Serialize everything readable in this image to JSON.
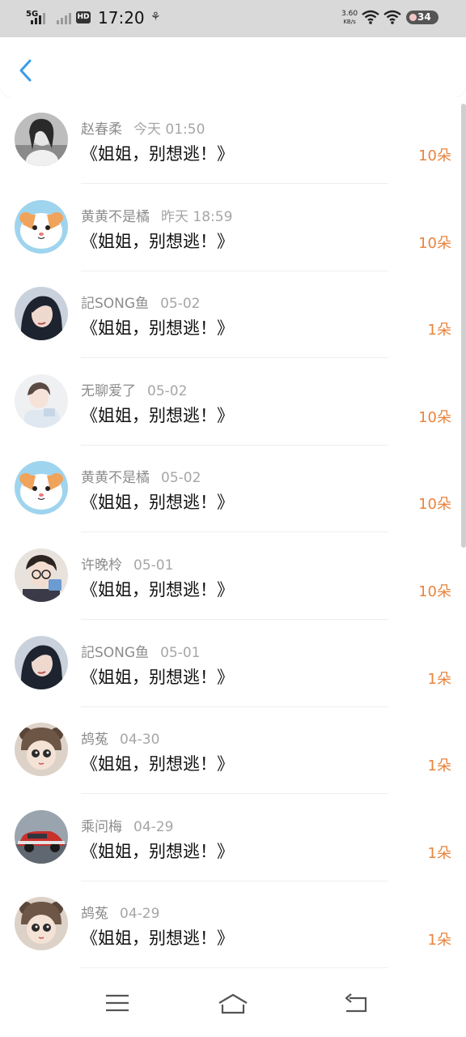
{
  "status_bar": {
    "network": "5G",
    "time": "17:20",
    "net_speed_value": "3.60",
    "net_speed_unit": "KB/s",
    "battery": "34"
  },
  "header": {
    "back_icon": "chevron-left-icon"
  },
  "items": [
    {
      "name": "赵春柔",
      "date": "今天 01:50",
      "title": "《姐姐，别想逃！》",
      "count": "10朵",
      "avatar": "girl-portrait-bw"
    },
    {
      "name": "黄黄不是橘",
      "date": "昨天 18:59",
      "title": "《姐姐，别想逃！》",
      "count": "10朵",
      "avatar": "cartoon-hamster"
    },
    {
      "name": "記SONG鱼",
      "date": "05-02",
      "title": "《姐姐，别想逃！》",
      "count": "1朵",
      "avatar": "woman-dark-hair"
    },
    {
      "name": "无聊爱了",
      "date": "05-02",
      "title": "《姐姐，别想逃！》",
      "count": "10朵",
      "avatar": "girl-light"
    },
    {
      "name": "黄黄不是橘",
      "date": "05-02",
      "title": "《姐姐，别想逃！》",
      "count": "10朵",
      "avatar": "cartoon-hamster"
    },
    {
      "name": "许晚柃",
      "date": "05-01",
      "title": "《姐姐，别想逃！》",
      "count": "10朵",
      "avatar": "boy-glasses"
    },
    {
      "name": "記SONG鱼",
      "date": "05-01",
      "title": "《姐姐，别想逃！》",
      "count": "1朵",
      "avatar": "woman-dark-hair"
    },
    {
      "name": "鸪菟",
      "date": "04-30",
      "title": "《姐姐，别想逃！》",
      "count": "1朵",
      "avatar": "girl-bear-hat"
    },
    {
      "name": "乘问梅",
      "date": "04-29",
      "title": "《姐姐，别想逃！》",
      "count": "1朵",
      "avatar": "red-car"
    },
    {
      "name": "鸪菟",
      "date": "04-29",
      "title": "《姐姐，别想逃！》",
      "count": "1朵",
      "avatar": "girl-bear-hat"
    }
  ],
  "nav_bar": {
    "menu_icon": "menu-icon",
    "home_icon": "home-icon",
    "back_icon": "back-icon"
  },
  "colors": {
    "accent_blue": "#3a9be6",
    "count_orange": "#e8843d",
    "status_bar_bg": "#d9d9d9"
  }
}
